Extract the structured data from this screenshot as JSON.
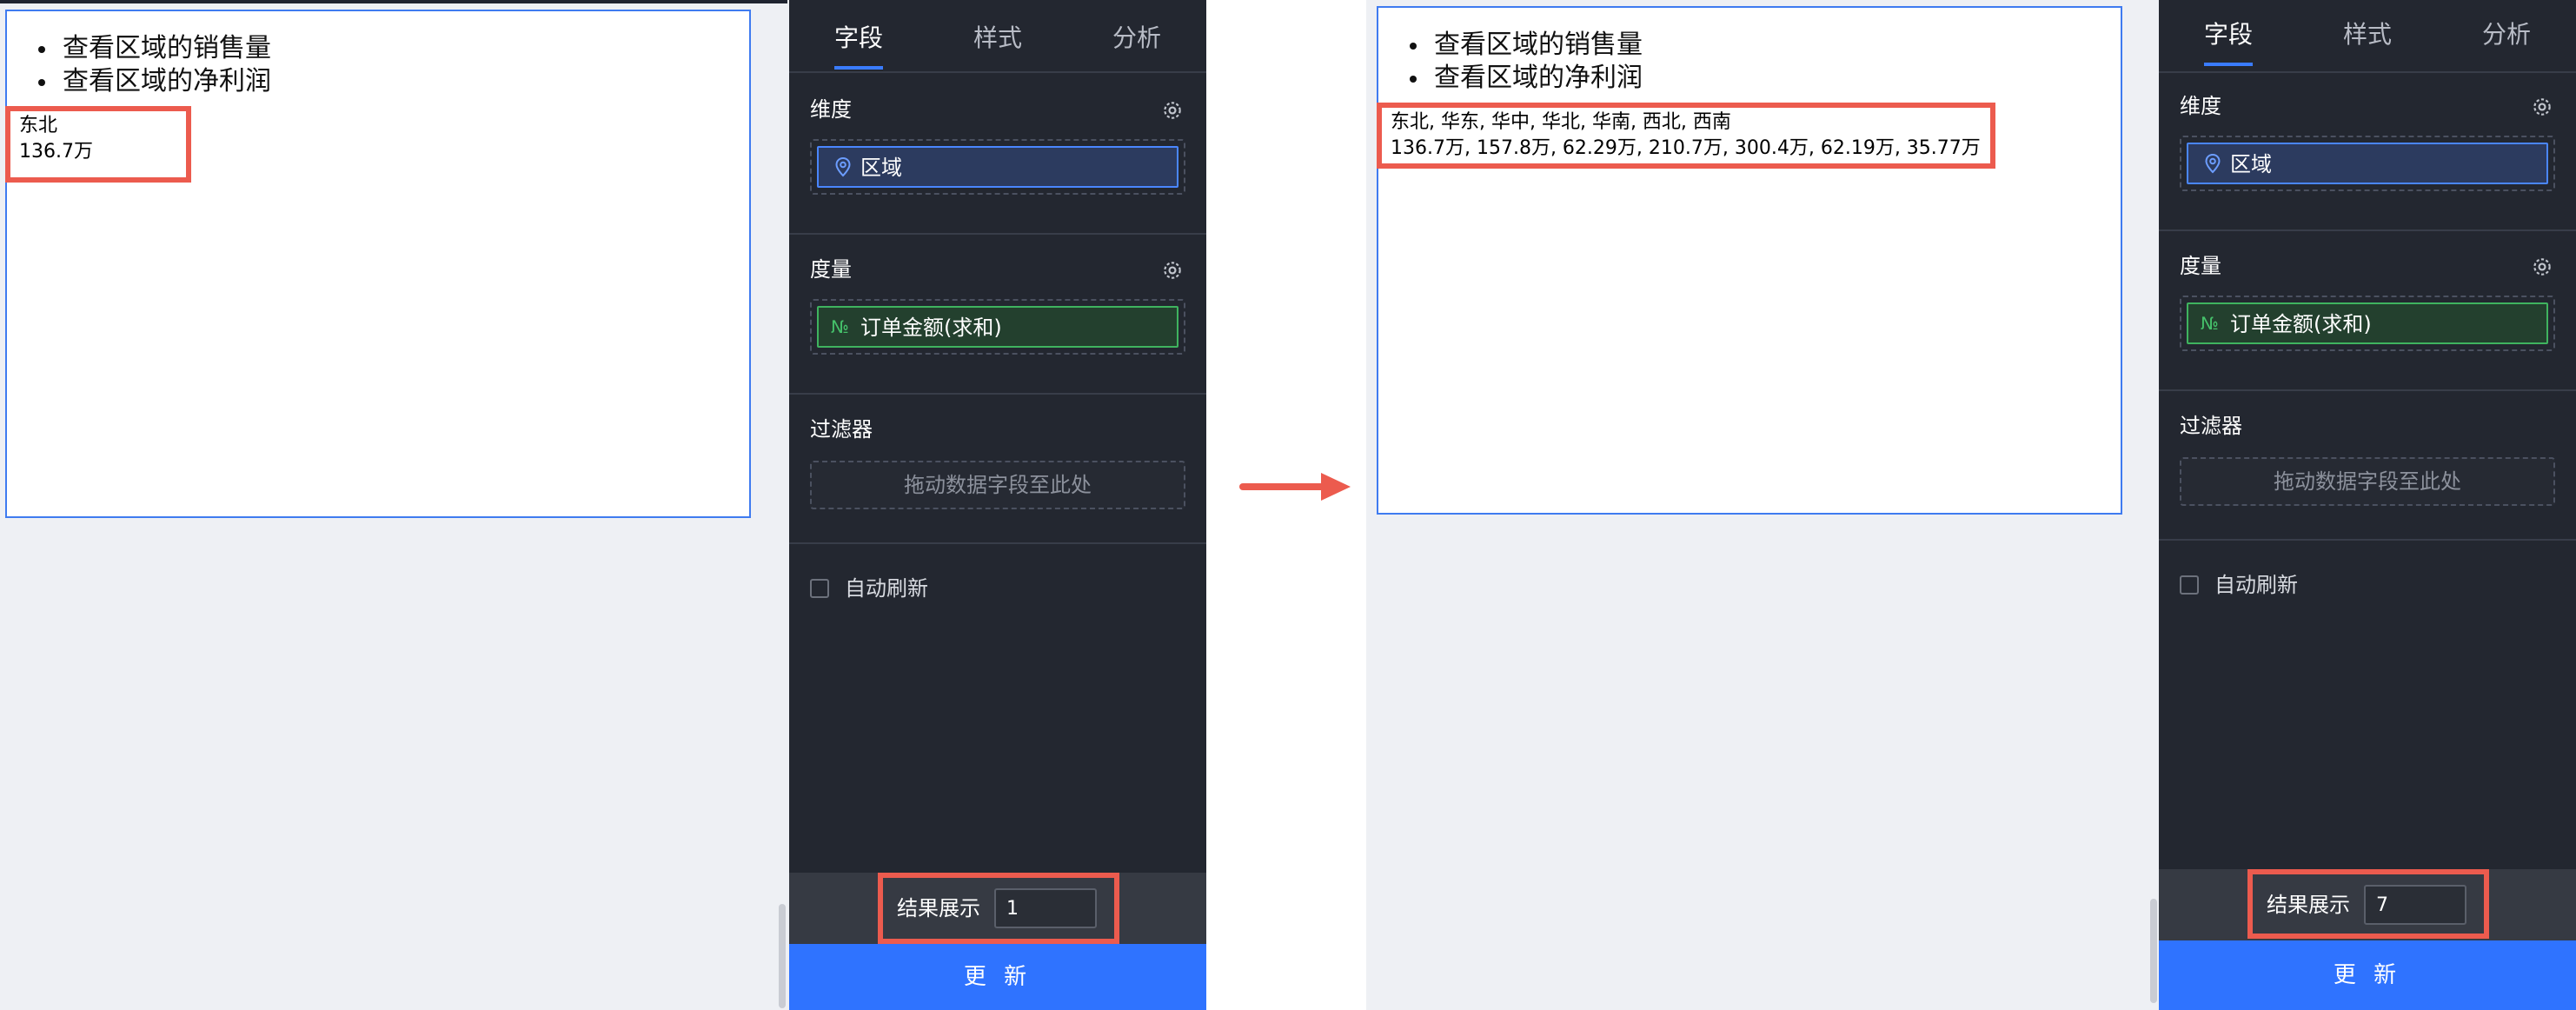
{
  "colors": {
    "accent": "#3a7cff",
    "highlight": "#ec5b4e",
    "dimension": "#4a86ff",
    "measure": "#3fb35f",
    "panel": "#232730",
    "update_button": "#2f73ff"
  },
  "before": {
    "canvas": {
      "bullets": [
        "查看区域的销售量",
        "查看区域的净利润"
      ],
      "result_lines": [
        "东北",
        "136.7万"
      ]
    },
    "panel": {
      "tabs": [
        "字段",
        "样式",
        "分析"
      ],
      "dimension": {
        "label": "维度",
        "icon": "location-pin-icon",
        "field": "区域"
      },
      "measure": {
        "label": "度量",
        "icon": "number-icon",
        "icon_glyph": "№",
        "field": "订单金额(求和)"
      },
      "filter": {
        "label": "过滤器",
        "placeholder": "拖动数据字段至此处"
      },
      "auto_refresh": {
        "label": "自动刷新",
        "checked": false
      },
      "result_display": {
        "label": "结果展示",
        "value": "1"
      },
      "update_button": "更 新"
    }
  },
  "after": {
    "canvas": {
      "bullets": [
        "查看区域的销售量",
        "查看区域的净利润"
      ],
      "result_lines": [
        "东北, 华东, 华中, 华北, 华南, 西北, 西南",
        "136.7万, 157.8万, 62.29万, 210.7万, 300.4万, 62.19万, 35.77万"
      ]
    },
    "panel": {
      "tabs": [
        "字段",
        "样式",
        "分析"
      ],
      "dimension": {
        "label": "维度",
        "icon": "location-pin-icon",
        "field": "区域"
      },
      "measure": {
        "label": "度量",
        "icon": "number-icon",
        "icon_glyph": "№",
        "field": "订单金额(求和)"
      },
      "filter": {
        "label": "过滤器",
        "placeholder": "拖动数据字段至此处"
      },
      "auto_refresh": {
        "label": "自动刷新",
        "checked": false
      },
      "result_display": {
        "label": "结果展示",
        "value": "7"
      },
      "update_button": "更 新"
    }
  },
  "arrow": {
    "icon": "right-arrow-icon"
  }
}
